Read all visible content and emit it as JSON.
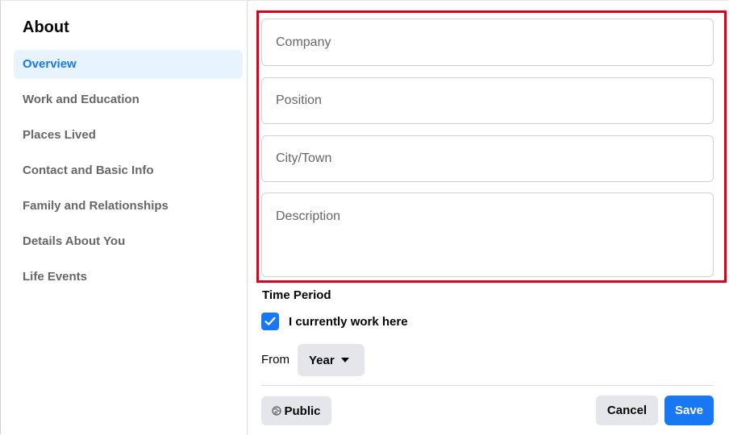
{
  "sidebar": {
    "title": "About",
    "items": [
      {
        "label": "Overview",
        "active": true
      },
      {
        "label": "Work and Education"
      },
      {
        "label": "Places Lived"
      },
      {
        "label": "Contact and Basic Info"
      },
      {
        "label": "Family and Relationships"
      },
      {
        "label": "Details About You"
      },
      {
        "label": "Life Events"
      }
    ]
  },
  "form": {
    "company": {
      "placeholder": "Company",
      "value": ""
    },
    "position": {
      "placeholder": "Position",
      "value": ""
    },
    "city": {
      "placeholder": "City/Town",
      "value": ""
    },
    "description": {
      "placeholder": "Description",
      "value": ""
    },
    "time_period_label": "Time Period",
    "currently_work_label": "I currently work here",
    "currently_work_checked": true,
    "from_label": "From",
    "year_selected": "Year"
  },
  "footer": {
    "privacy_label": "Public",
    "cancel_label": "Cancel",
    "save_label": "Save"
  },
  "colors": {
    "accent": "#1877f2",
    "active_bg": "#e7f3ff",
    "highlight_border": "#e0001b",
    "secondary_button": "#e4e6eb"
  },
  "icons": {
    "checkbox": "check-icon",
    "year_dropdown": "caret-down-icon",
    "privacy": "globe-icon"
  }
}
